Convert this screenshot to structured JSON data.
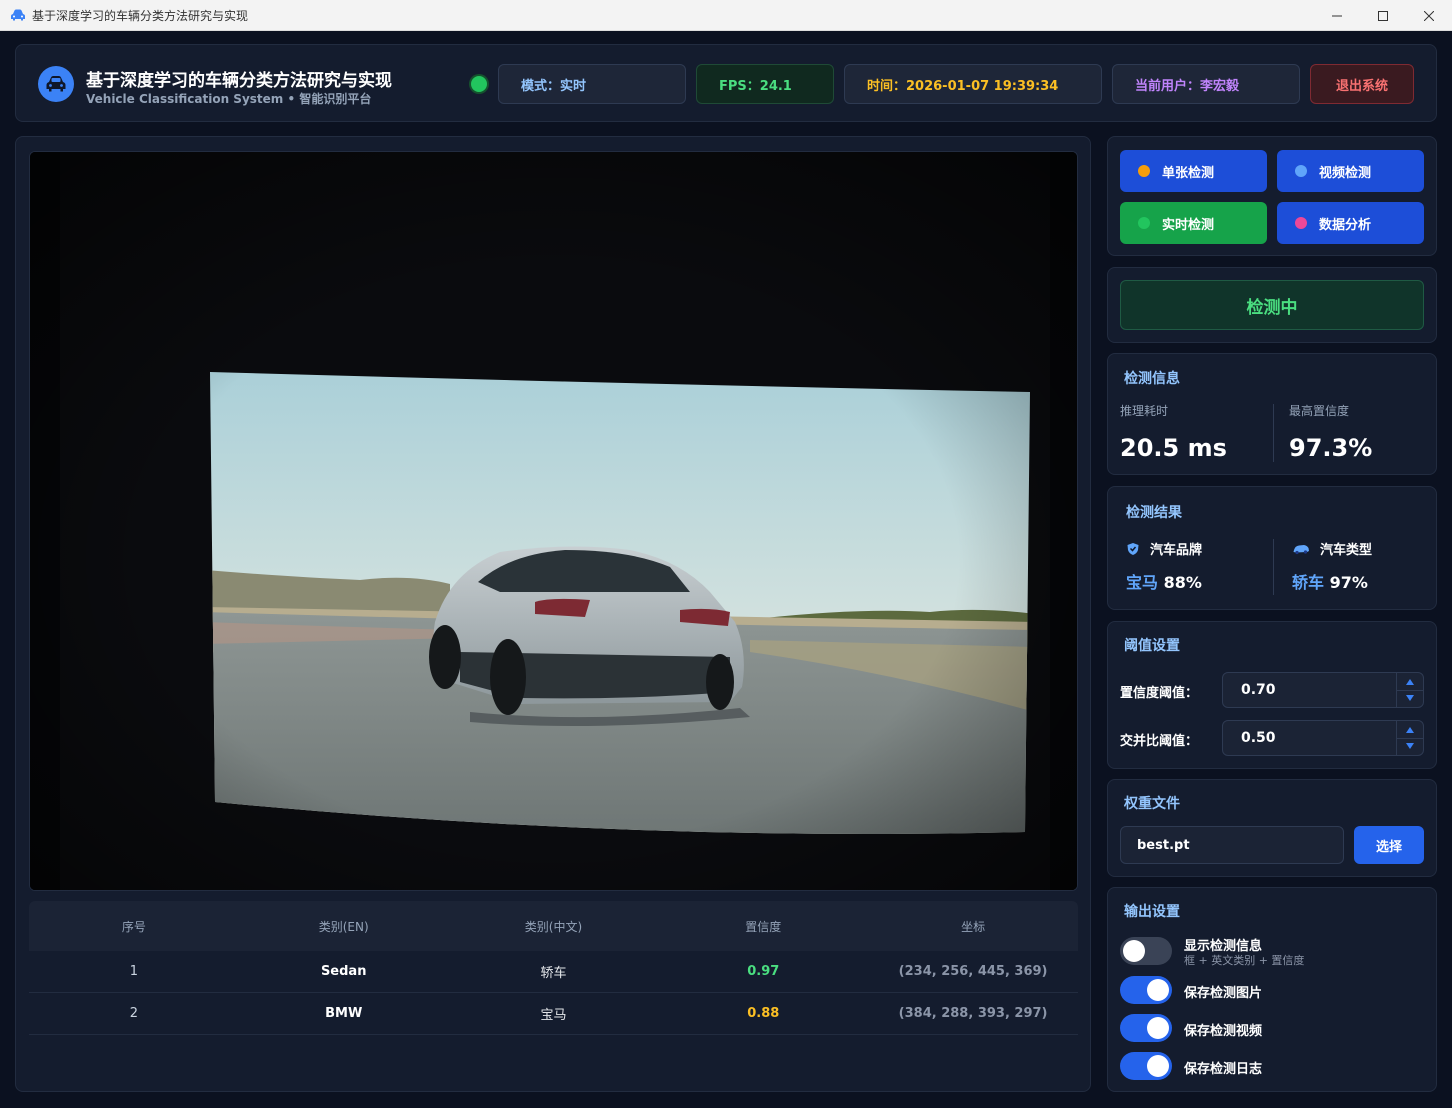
{
  "window": {
    "title": "基于深度学习的车辆分类方法研究与实现",
    "icons": [
      "car-icon",
      "minimize-icon",
      "maximize-icon",
      "close-icon"
    ]
  },
  "header": {
    "title": "基于深度学习的车辆分类方法研究与实现",
    "subtitle": "Vehicle Classification System • 智能识别平台",
    "mode": "模式：实时",
    "fps": "FPS：24.1",
    "time": "时间：2026-01-07 19:39:34",
    "user": "当前用户：李宏毅",
    "logout": "退出系统",
    "status_color": "#22c55e"
  },
  "table": {
    "headers": [
      "序号",
      "类别(EN)",
      "类别(中文)",
      "置信度",
      "坐标"
    ],
    "rows": [
      [
        "1",
        "Sedan",
        "轿车",
        "0.97",
        "(234, 256, 445, 369)"
      ],
      [
        "2",
        "BMW",
        "宝马",
        "0.88",
        "(384, 288, 393, 297)"
      ]
    ]
  },
  "modes": {
    "single": "单张检测",
    "video": "视频检测",
    "realtime": "实时检测",
    "data": "数据分析",
    "dot_colors": [
      "#f59e0b",
      "#60a5fa",
      "#22c55e",
      "#ec4899"
    ]
  },
  "status": {
    "detecting": "检测中"
  },
  "info": {
    "title": "检测信息",
    "infer_label": "推理耗时",
    "infer_value": "20.5 ms",
    "conf_label": "最高置信度",
    "conf_value": "97.3%"
  },
  "result": {
    "title": "检测结果",
    "brand_label": "汽车品牌",
    "brand_value": "宝马",
    "brand_pct": "88%",
    "type_label": "汽车类型",
    "type_value": "轿车",
    "type_pct": "97%"
  },
  "threshold": {
    "title": "阈值设置",
    "conf_label": "置信度阈值：",
    "conf_value": "0.70",
    "iou_label": "交并比阈值：",
    "iou_value": "0.50"
  },
  "weights": {
    "title": "权重文件",
    "file": "best.pt",
    "choose": "选择"
  },
  "output": {
    "title": "输出设置",
    "show_info": "显示检测信息",
    "show_info_sub": "框 + 英文类别 + 置信度",
    "save_image": "保存检测图片",
    "save_video": "保存检测视频",
    "save_log": "保存检测日志",
    "toggles": [
      false,
      true,
      true,
      true
    ]
  }
}
